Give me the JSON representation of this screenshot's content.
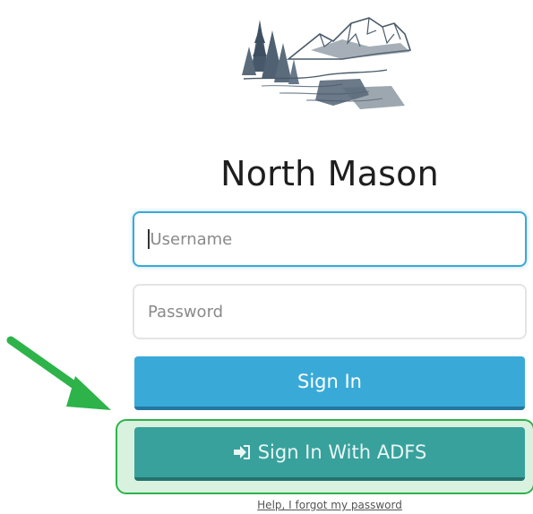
{
  "brand": {
    "logo_icon": "mountain-lake-trees-logo",
    "title": "North Mason"
  },
  "form": {
    "username_placeholder": "Username",
    "password_placeholder": "Password",
    "signin_label": "Sign In",
    "adfs_label": "Sign In With ADFS",
    "adfs_icon": "sign-in-arrow-icon",
    "help_link": "Help, I forgot my password"
  },
  "annotation": {
    "arrow_icon": "green-pointer-arrow",
    "arrow_color": "#2db34a",
    "highlight_color": "#2db34a"
  },
  "colors": {
    "signin_button": "#39aad7",
    "adfs_button": "#38a19c",
    "focus_border": "#3aa9d6"
  }
}
